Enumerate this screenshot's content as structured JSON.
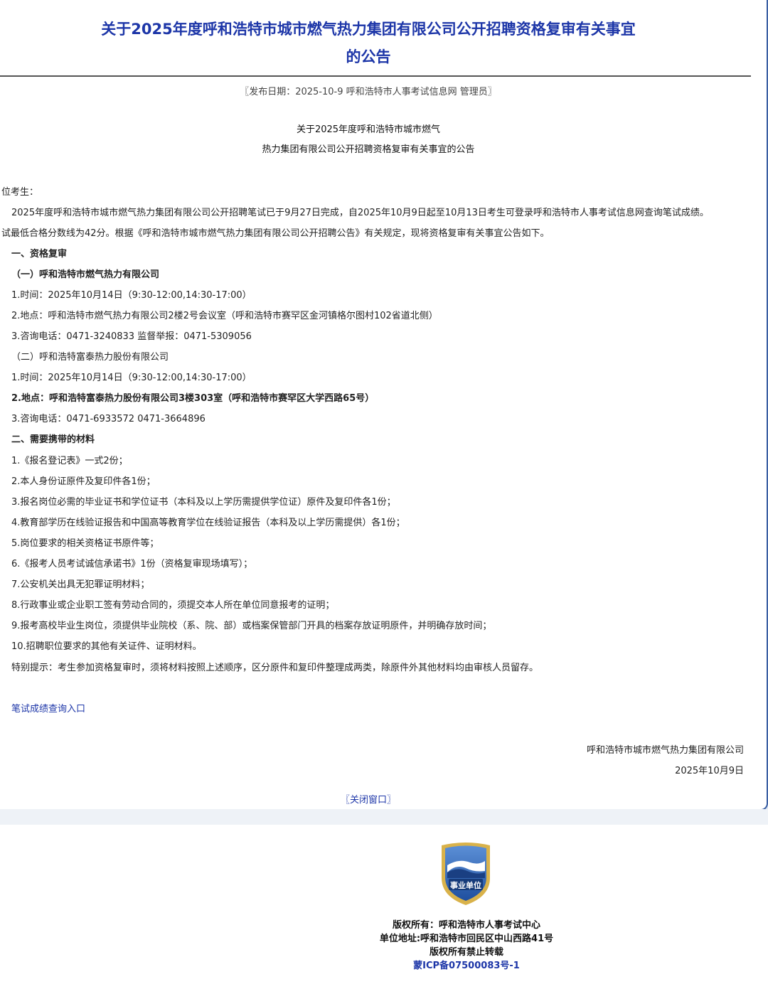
{
  "header": {
    "title_line1": "关于2025年度呼和浩特市城市燃气热力集团有限公司公开招聘资格复审有关事宜",
    "title_line2": "的公告",
    "meta": "〖发布日期：2025-10-9 呼和浩特市人事考试信息网 管理员〗"
  },
  "article": {
    "subtitle_line1": "关于2025年度呼和浩特市城市燃气",
    "subtitle_line2": "热力集团有限公司公开招聘资格复审有关事宜的公告",
    "greeting": "位考生：",
    "intro1": "2025年度呼和浩特市城市燃气热力集团有限公司公开招聘笔试已于9月27日完成，自2025年10月9日起至10月13日考生可登录呼和浩特市人事考试信息网查询笔试成绩。",
    "intro2": "试最低合格分数线为42分。根据《呼和浩特市城市燃气热力集团有限公司公开招聘公告》有关规定，现将资格复审有关事宜公告如下。",
    "section1": "一、资格复审",
    "company1": "（一）呼和浩特市燃气热力有限公司",
    "c1_time": "1.时间：2025年10月14日（9:30-12:00,14:30-17:00）",
    "c1_place": "2.地点：呼和浩特市燃气热力有限公司2楼2号会议室（呼和浩特市赛罕区金河镇格尔图村102省道北侧）",
    "c1_phone": "3.咨询电话：0471-3240833   监督举报：0471-5309056",
    "company2": "（二）呼和浩特富泰热力股份有限公司",
    "c2_time": "1.时间：2025年10月14日（9:30-12:00,14:30-17:00）",
    "c2_place": "2.地点：呼和浩特富泰热力股份有限公司3楼303室（呼和浩特市赛罕区大学西路65号）",
    "c2_phone": "3.咨询电话：0471-6933572      0471-3664896",
    "section2": "二、需要携带的材料",
    "materials": [
      "1.《报名登记表》一式2份；",
      "2.本人身份证原件及复印件各1份；",
      "3.报名岗位必需的毕业证书和学位证书（本科及以上学历需提供学位证）原件及复印件各1份；",
      "4.教育部学历在线验证报告和中国高等教育学位在线验证报告（本科及以上学历需提供）各1份；",
      "5.岗位要求的相关资格证书原件等；",
      "6.《报考人员考试诚信承诺书》1份（资格复审现场填写）；",
      "7.公安机关出具无犯罪证明材料；",
      "8.行政事业或企业职工签有劳动合同的，须提交本人所在单位同意报考的证明；",
      "9.报考高校毕业生岗位，须提供毕业院校（系、院、部）或档案保管部门开具的档案存放证明原件，并明确存放时间；",
      "10.招聘职位要求的其他有关证件、证明材料。"
    ],
    "note": "特别提示：考生参加资格复审时，须将材料按照上述顺序，区分原件和复印件整理成两类，除原件外其他材料均由审核人员留存。",
    "score_link": "笔试成绩查询入口",
    "sign_org": "呼和浩特市城市燃气热力集团有限公司",
    "sign_date": "2025年10月9日",
    "close": "〖关闭窗口〗"
  },
  "footer": {
    "logo_text": "事业单位",
    "copyright": "版权所有：呼和浩特市人事考试中心",
    "address": "单位地址:呼和浩特市回民区中山西路41号",
    "rights": "版权所有禁止转载",
    "icp": "蒙ICP备07500083号-1"
  },
  "colors": {
    "title": "#1d36a8",
    "link": "#1d36a8",
    "border": "#3a5fa3"
  }
}
